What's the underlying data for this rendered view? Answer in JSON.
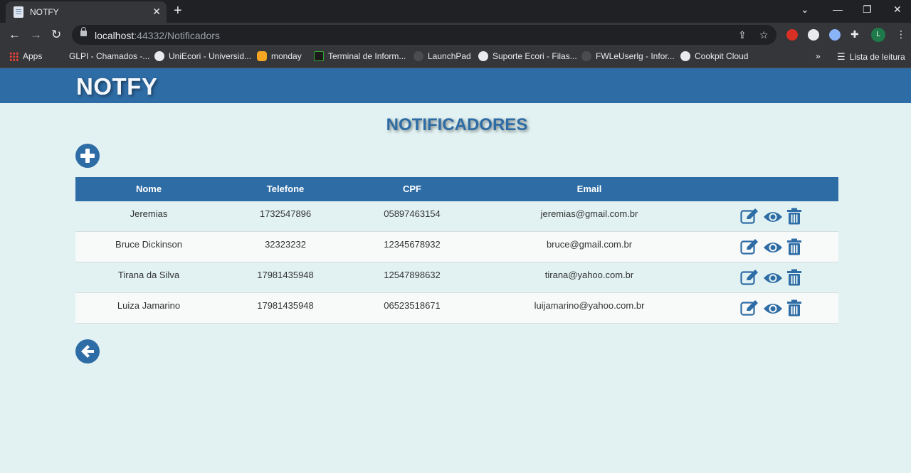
{
  "browser": {
    "tab_title": "NOTFY",
    "url_host": "localhost",
    "url_rest": ":44332/Notificadors",
    "bookmarks": [
      "Apps",
      "GLPI - Chamados -...",
      "UniEcori - Universid...",
      "monday",
      "Terminal de Inform...",
      "LaunchPad",
      "Suporte Ecori - Filas...",
      "FWLeUserlg - Infor...",
      "Cookpit Cloud"
    ],
    "reading_list": "Lista de leitura",
    "profile_initial": "L"
  },
  "page": {
    "brand": "NOTFY",
    "heading": "NOTIFICADORES",
    "columns": [
      "Nome",
      "Telefone",
      "CPF",
      "Email"
    ],
    "rows": [
      {
        "nome": "Jeremias",
        "telefone": "1732547896",
        "cpf": "05897463154",
        "email": "jeremias@gmail.com.br"
      },
      {
        "nome": "Bruce Dickinson",
        "telefone": "32323232",
        "cpf": "12345678932",
        "email": "bruce@gmail.com.br"
      },
      {
        "nome": "Tirana da Silva",
        "telefone": "17981435948",
        "cpf": "12547898632",
        "email": "tirana@yahoo.com.br"
      },
      {
        "nome": "Luiza Jamarino",
        "telefone": "17981435948",
        "cpf": "06523518671",
        "email": "luijamarino@yahoo.com.br"
      }
    ],
    "icons": {
      "add": "plus-circle-icon",
      "back": "arrow-left-circle-icon",
      "edit": "edit-icon",
      "view": "eye-icon",
      "delete": "trash-icon"
    }
  },
  "colors": {
    "primary": "#2e6ca5",
    "background": "#e2f2f2",
    "row_alt": "#f8f9f9"
  }
}
